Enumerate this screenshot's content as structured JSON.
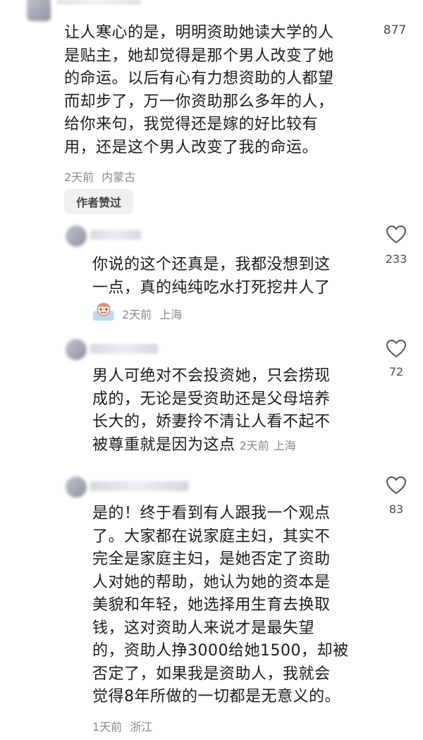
{
  "comments": [
    {
      "text": "让人寒心的是，明明资助她读大学的人\n是贴主，她却觉得是那个男人改变了她\n的命运。以后有心有力想资助的人都望\n而却步了，万一你资助那么多年的人，\n给你来句，我觉得还是嫁的好比较有\n用，还是这个男人改变了我的命运。",
      "time": "2天前",
      "location": "内蒙古",
      "likes": "877",
      "badge": "作者赞过"
    },
    {
      "text": "你说的这个还真是，我都没想到这\n一点，真的纯纯吃水打死挖井人了",
      "time": "2天前",
      "location": "上海",
      "likes": "233",
      "sticker": "emoji-sticker-icon"
    },
    {
      "text": "男人可绝对不会投资她，只会捞现\n成的，无论是受资助还是父母培养\n长大的，娇妻拎不清让人看不起不\n被尊重就是因为这点",
      "time": "2天前",
      "location": "上海",
      "likes": "72"
    },
    {
      "text": "是的！终于看到有人跟我一个观点\n了。大家都在说家庭主妇，其实不\n完全是家庭主妇，是她否定了资助\n人对她的帮助，她认为她的资本是\n美貌和年轻，她选择用生育去换取\n钱，这对资助人来说才是最失望\n的，资助人挣3000给她1500，却被\n否定了，如果我是资助人，我就会\n觉得8年所做的一切都是无意义的。",
      "time": "1天前",
      "location": "浙江",
      "likes": "83"
    }
  ],
  "colors": {
    "text": "#1c1c1c",
    "meta": "#8a8a8a",
    "badge_bg": "#f0f0f0"
  }
}
